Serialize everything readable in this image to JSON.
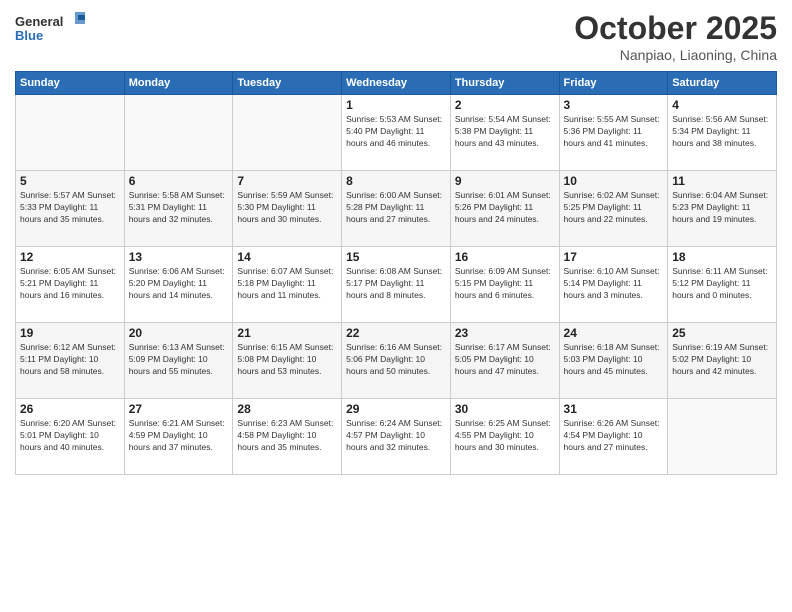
{
  "header": {
    "logo_general": "General",
    "logo_blue": "Blue",
    "title": "October 2025",
    "location": "Nanpiao, Liaoning, China"
  },
  "days_of_week": [
    "Sunday",
    "Monday",
    "Tuesday",
    "Wednesday",
    "Thursday",
    "Friday",
    "Saturday"
  ],
  "weeks": [
    [
      {
        "day": "",
        "info": ""
      },
      {
        "day": "",
        "info": ""
      },
      {
        "day": "",
        "info": ""
      },
      {
        "day": "1",
        "info": "Sunrise: 5:53 AM\nSunset: 5:40 PM\nDaylight: 11 hours and 46 minutes."
      },
      {
        "day": "2",
        "info": "Sunrise: 5:54 AM\nSunset: 5:38 PM\nDaylight: 11 hours and 43 minutes."
      },
      {
        "day": "3",
        "info": "Sunrise: 5:55 AM\nSunset: 5:36 PM\nDaylight: 11 hours and 41 minutes."
      },
      {
        "day": "4",
        "info": "Sunrise: 5:56 AM\nSunset: 5:34 PM\nDaylight: 11 hours and 38 minutes."
      }
    ],
    [
      {
        "day": "5",
        "info": "Sunrise: 5:57 AM\nSunset: 5:33 PM\nDaylight: 11 hours and 35 minutes."
      },
      {
        "day": "6",
        "info": "Sunrise: 5:58 AM\nSunset: 5:31 PM\nDaylight: 11 hours and 32 minutes."
      },
      {
        "day": "7",
        "info": "Sunrise: 5:59 AM\nSunset: 5:30 PM\nDaylight: 11 hours and 30 minutes."
      },
      {
        "day": "8",
        "info": "Sunrise: 6:00 AM\nSunset: 5:28 PM\nDaylight: 11 hours and 27 minutes."
      },
      {
        "day": "9",
        "info": "Sunrise: 6:01 AM\nSunset: 5:26 PM\nDaylight: 11 hours and 24 minutes."
      },
      {
        "day": "10",
        "info": "Sunrise: 6:02 AM\nSunset: 5:25 PM\nDaylight: 11 hours and 22 minutes."
      },
      {
        "day": "11",
        "info": "Sunrise: 6:04 AM\nSunset: 5:23 PM\nDaylight: 11 hours and 19 minutes."
      }
    ],
    [
      {
        "day": "12",
        "info": "Sunrise: 6:05 AM\nSunset: 5:21 PM\nDaylight: 11 hours and 16 minutes."
      },
      {
        "day": "13",
        "info": "Sunrise: 6:06 AM\nSunset: 5:20 PM\nDaylight: 11 hours and 14 minutes."
      },
      {
        "day": "14",
        "info": "Sunrise: 6:07 AM\nSunset: 5:18 PM\nDaylight: 11 hours and 11 minutes."
      },
      {
        "day": "15",
        "info": "Sunrise: 6:08 AM\nSunset: 5:17 PM\nDaylight: 11 hours and 8 minutes."
      },
      {
        "day": "16",
        "info": "Sunrise: 6:09 AM\nSunset: 5:15 PM\nDaylight: 11 hours and 6 minutes."
      },
      {
        "day": "17",
        "info": "Sunrise: 6:10 AM\nSunset: 5:14 PM\nDaylight: 11 hours and 3 minutes."
      },
      {
        "day": "18",
        "info": "Sunrise: 6:11 AM\nSunset: 5:12 PM\nDaylight: 11 hours and 0 minutes."
      }
    ],
    [
      {
        "day": "19",
        "info": "Sunrise: 6:12 AM\nSunset: 5:11 PM\nDaylight: 10 hours and 58 minutes."
      },
      {
        "day": "20",
        "info": "Sunrise: 6:13 AM\nSunset: 5:09 PM\nDaylight: 10 hours and 55 minutes."
      },
      {
        "day": "21",
        "info": "Sunrise: 6:15 AM\nSunset: 5:08 PM\nDaylight: 10 hours and 53 minutes."
      },
      {
        "day": "22",
        "info": "Sunrise: 6:16 AM\nSunset: 5:06 PM\nDaylight: 10 hours and 50 minutes."
      },
      {
        "day": "23",
        "info": "Sunrise: 6:17 AM\nSunset: 5:05 PM\nDaylight: 10 hours and 47 minutes."
      },
      {
        "day": "24",
        "info": "Sunrise: 6:18 AM\nSunset: 5:03 PM\nDaylight: 10 hours and 45 minutes."
      },
      {
        "day": "25",
        "info": "Sunrise: 6:19 AM\nSunset: 5:02 PM\nDaylight: 10 hours and 42 minutes."
      }
    ],
    [
      {
        "day": "26",
        "info": "Sunrise: 6:20 AM\nSunset: 5:01 PM\nDaylight: 10 hours and 40 minutes."
      },
      {
        "day": "27",
        "info": "Sunrise: 6:21 AM\nSunset: 4:59 PM\nDaylight: 10 hours and 37 minutes."
      },
      {
        "day": "28",
        "info": "Sunrise: 6:23 AM\nSunset: 4:58 PM\nDaylight: 10 hours and 35 minutes."
      },
      {
        "day": "29",
        "info": "Sunrise: 6:24 AM\nSunset: 4:57 PM\nDaylight: 10 hours and 32 minutes."
      },
      {
        "day": "30",
        "info": "Sunrise: 6:25 AM\nSunset: 4:55 PM\nDaylight: 10 hours and 30 minutes."
      },
      {
        "day": "31",
        "info": "Sunrise: 6:26 AM\nSunset: 4:54 PM\nDaylight: 10 hours and 27 minutes."
      },
      {
        "day": "",
        "info": ""
      }
    ]
  ]
}
